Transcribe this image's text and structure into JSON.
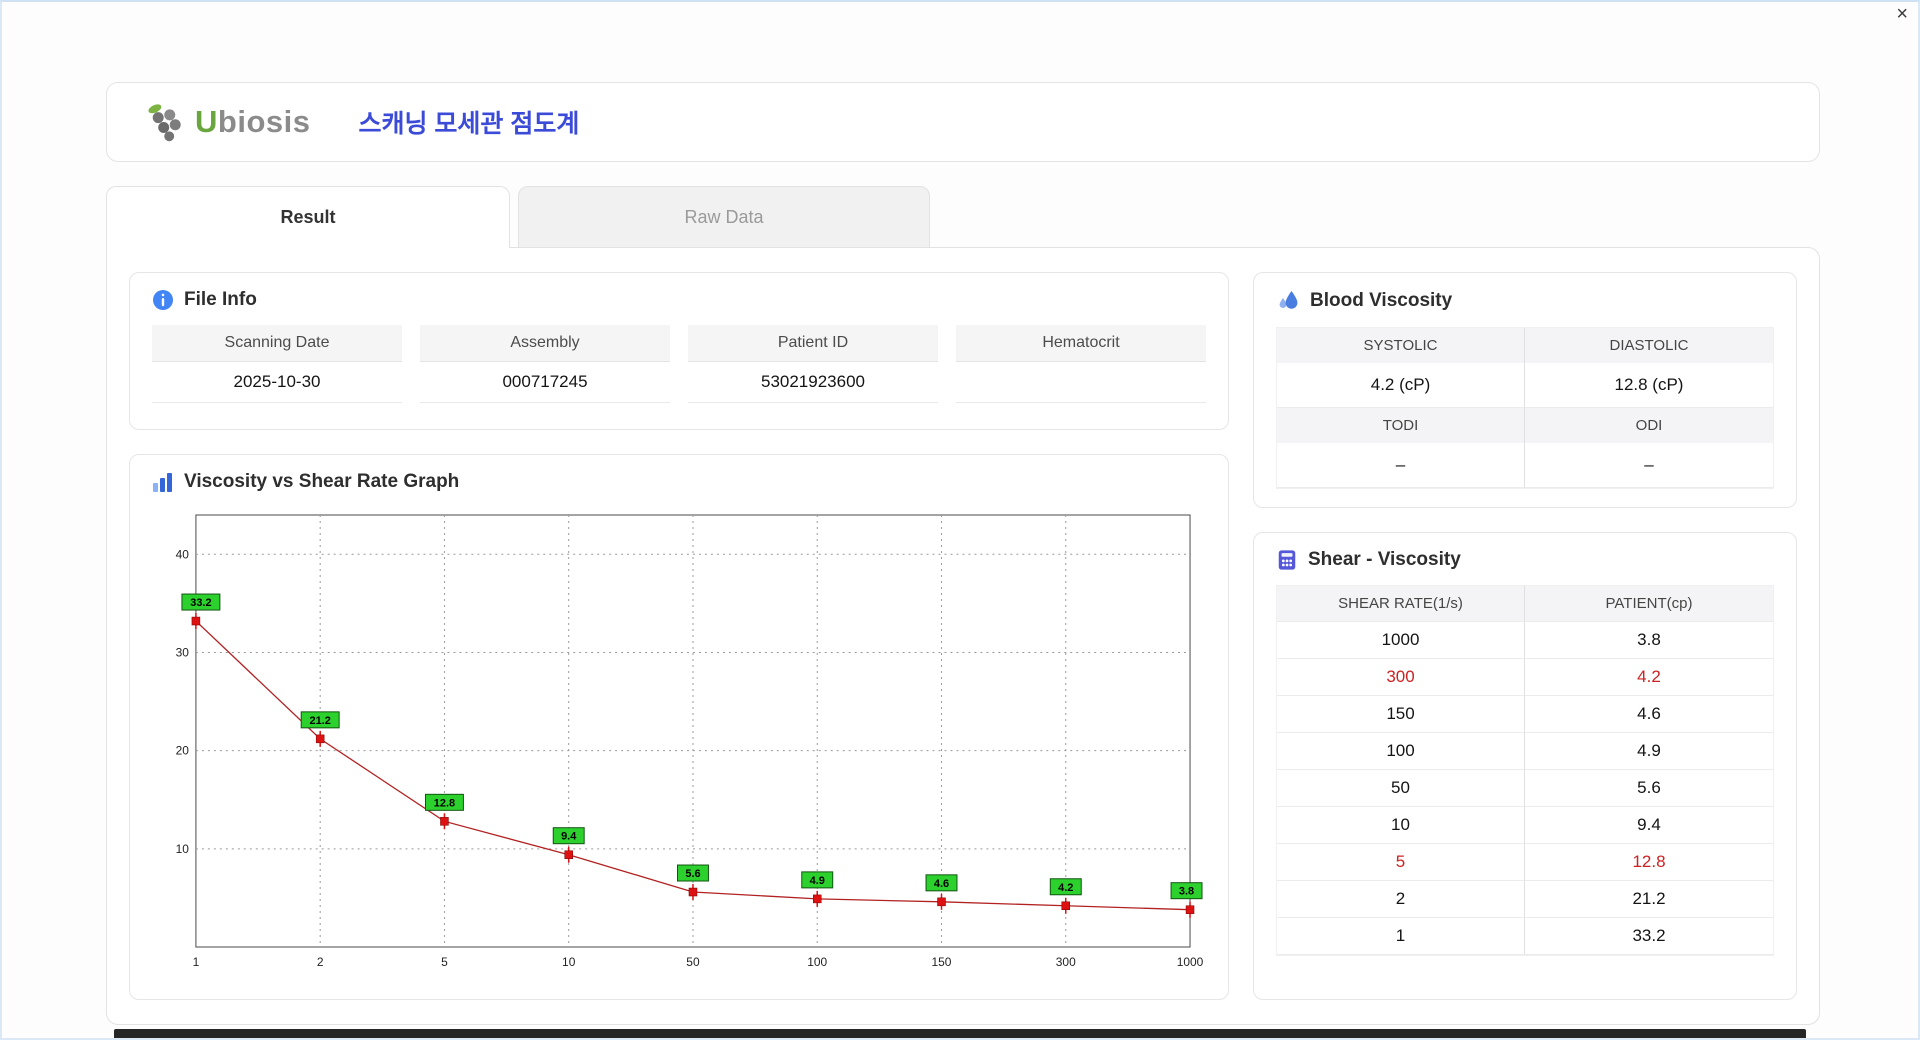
{
  "window": {
    "close": "×"
  },
  "header": {
    "brand_initial": "U",
    "brand_rest": "biosis",
    "title": "스캐닝 모세관 점도계"
  },
  "tabs": {
    "result": "Result",
    "raw_data": "Raw Data"
  },
  "file_info": {
    "title": "File Info",
    "fields": [
      {
        "label": "Scanning Date",
        "value": "2025-10-30"
      },
      {
        "label": "Assembly",
        "value": "000717245"
      },
      {
        "label": "Patient ID",
        "value": "53021923600"
      },
      {
        "label": "Hematocrit",
        "value": ""
      }
    ]
  },
  "blood_viscosity": {
    "title": "Blood Viscosity",
    "systolic_label": "SYSTOLIC",
    "systolic_value": "4.2 (cP)",
    "diastolic_label": "DIASTOLIC",
    "diastolic_value": "12.8 (cP)",
    "todi_label": "TODI",
    "todi_value": "–",
    "odi_label": "ODI",
    "odi_value": "–"
  },
  "shear_viscosity": {
    "title": "Shear - Viscosity",
    "columns": [
      "SHEAR RATE(1/s)",
      "PATIENT(cp)"
    ],
    "highlight_color": "#cc2222",
    "rows": [
      {
        "shear": "1000",
        "patient": "3.8",
        "highlight": false
      },
      {
        "shear": "300",
        "patient": "4.2",
        "highlight": true
      },
      {
        "shear": "150",
        "patient": "4.6",
        "highlight": false
      },
      {
        "shear": "100",
        "patient": "4.9",
        "highlight": false
      },
      {
        "shear": "50",
        "patient": "5.6",
        "highlight": false
      },
      {
        "shear": "10",
        "patient": "9.4",
        "highlight": false
      },
      {
        "shear": "5",
        "patient": "12.8",
        "highlight": true
      },
      {
        "shear": "2",
        "patient": "21.2",
        "highlight": false
      },
      {
        "shear": "1",
        "patient": "33.2",
        "highlight": false
      }
    ]
  },
  "chart_data": {
    "type": "line",
    "title": "Viscosity vs Shear Rate Graph",
    "x": [
      1,
      2,
      5,
      10,
      50,
      100,
      150,
      300,
      1000
    ],
    "values": [
      33.2,
      21.2,
      12.8,
      9.4,
      5.6,
      4.9,
      4.6,
      4.2,
      3.8
    ],
    "xlabel": "",
    "ylabel": "",
    "x_axis": "category",
    "ylim": [
      0,
      44
    ],
    "yticks": [
      10,
      20,
      30,
      40
    ],
    "grid": "dotted",
    "line_color": "#b22222",
    "marker_color": "#dd1111",
    "point_label_bg": "#2dd12d"
  }
}
